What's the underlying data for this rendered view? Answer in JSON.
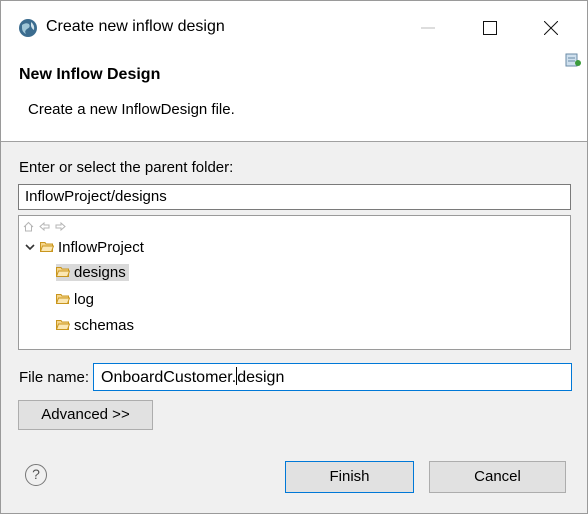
{
  "window": {
    "title": "Create new inflow design",
    "controls": [
      "minimize-icon",
      "maximize-icon",
      "close-icon"
    ]
  },
  "banner": {
    "title": "New Inflow Design",
    "description": "Create a new InflowDesign file."
  },
  "folder": {
    "label": "Enter or select the parent folder:",
    "value": "InflowProject/designs",
    "toolbar_icons": [
      "home-icon",
      "back-arrow-icon",
      "forward-arrow-icon"
    ],
    "tree": {
      "root": "InflowProject",
      "children": [
        "designs",
        "log",
        "schemas"
      ],
      "selected": "designs"
    }
  },
  "file": {
    "label": "File name:",
    "value_before_caret": "OnboardCustomer.",
    "value_after_caret": "design"
  },
  "buttons": {
    "advanced": "Advanced >>",
    "finish": "Finish",
    "cancel": "Cancel",
    "help": "?"
  }
}
